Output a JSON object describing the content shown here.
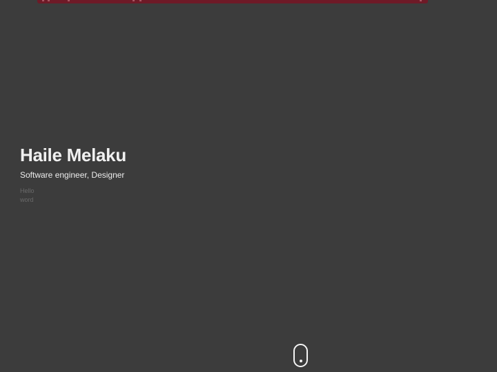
{
  "hero": {
    "name": "Haile Melaku",
    "subtitle": "Software engineer, Designer",
    "greeting": "Hello word"
  },
  "colors": {
    "background": "#3c3c3c",
    "top_strip": "#6e1a27",
    "heading": "#f0f0f0",
    "greeting": "#6a6a6a"
  },
  "icons": {
    "scroll_indicator": "mouse-scroll-icon"
  }
}
